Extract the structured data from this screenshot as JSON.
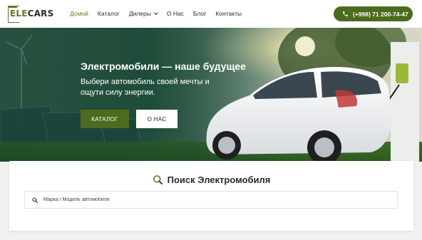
{
  "header": {
    "logo": {
      "part1": "ELE",
      "part2": "CARS"
    },
    "nav": [
      {
        "label": "Домой",
        "active": true
      },
      {
        "label": "Каталог",
        "active": false
      },
      {
        "label": "Дилеры",
        "active": false,
        "has_dropdown": true
      },
      {
        "label": "О Нас",
        "active": false
      },
      {
        "label": "Блог",
        "active": false
      },
      {
        "label": "Контакты",
        "active": false
      }
    ],
    "phone": "(+998) 71 200-74-47",
    "phone_icon": "phone-icon"
  },
  "hero": {
    "title": "Электромобили — наше будущее",
    "subtitle": "Выбери автомобиль своей мечты и ощути силу энергии.",
    "catalog_button": "КАТАЛОГ",
    "about_button": "О НАС"
  },
  "search": {
    "title": "Поиск Электромобиля",
    "title_icon": "search-icon",
    "placeholder": "Марка / Модель автомобиля",
    "value": ""
  },
  "colors": {
    "accent": "#4b6b1f",
    "nav_active": "#5f7a2e",
    "page_bg": "#f1f2f0"
  }
}
